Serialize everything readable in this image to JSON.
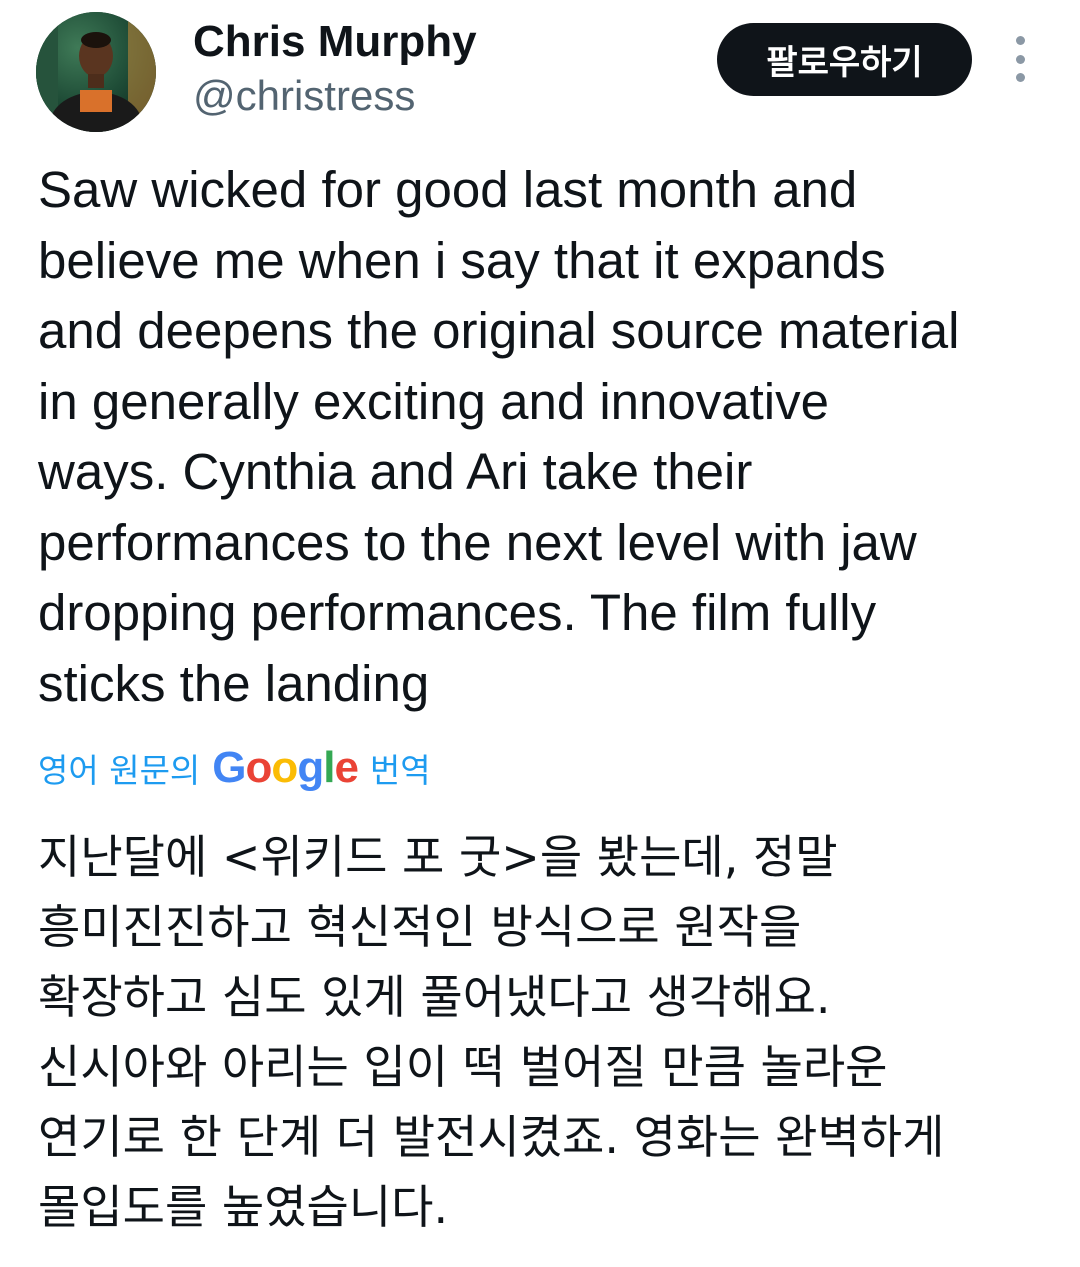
{
  "author": {
    "display_name": "Chris Murphy",
    "handle": "@christress"
  },
  "actions": {
    "follow_label": "팔로우하기"
  },
  "tweet": {
    "lines": [
      "Saw wicked for good last month and",
      "believe me when i say that it expands",
      "and deepens the original source material",
      "in generally exciting and innovative",
      "ways. Cynthia and Ari take their",
      "performances to the next level with jaw",
      "dropping performances. The film fully",
      "sticks the landing"
    ]
  },
  "translation": {
    "prefix": "영어 원문의",
    "google_logo": [
      "G",
      "o",
      "o",
      "g",
      "l",
      "e"
    ],
    "suffix": "번역",
    "lines": [
      "지난달에 <위키드 포 굿>을 봤는데, 정말",
      "흥미진진하고 혁신적인 방식으로 원작을",
      "확장하고 심도 있게 풀어냈다고 생각해요.",
      "신시아와 아리는 입이 떡 벌어질 만큼 놀라운",
      "연기로 한 단계 더 발전시켰죠. 영화는 완벽하게",
      "몰입도를 높였습니다."
    ]
  },
  "icons": {
    "more": "more-vertical-icon",
    "avatar": "avatar"
  },
  "colors": {
    "text": "#0f1419",
    "secondary": "#536471",
    "link": "#1d9bf0",
    "follow_bg": "#0f1419",
    "google_blue": "#4285f4",
    "google_red": "#ea4335",
    "google_yellow": "#fbbc05",
    "google_green": "#34a853"
  }
}
